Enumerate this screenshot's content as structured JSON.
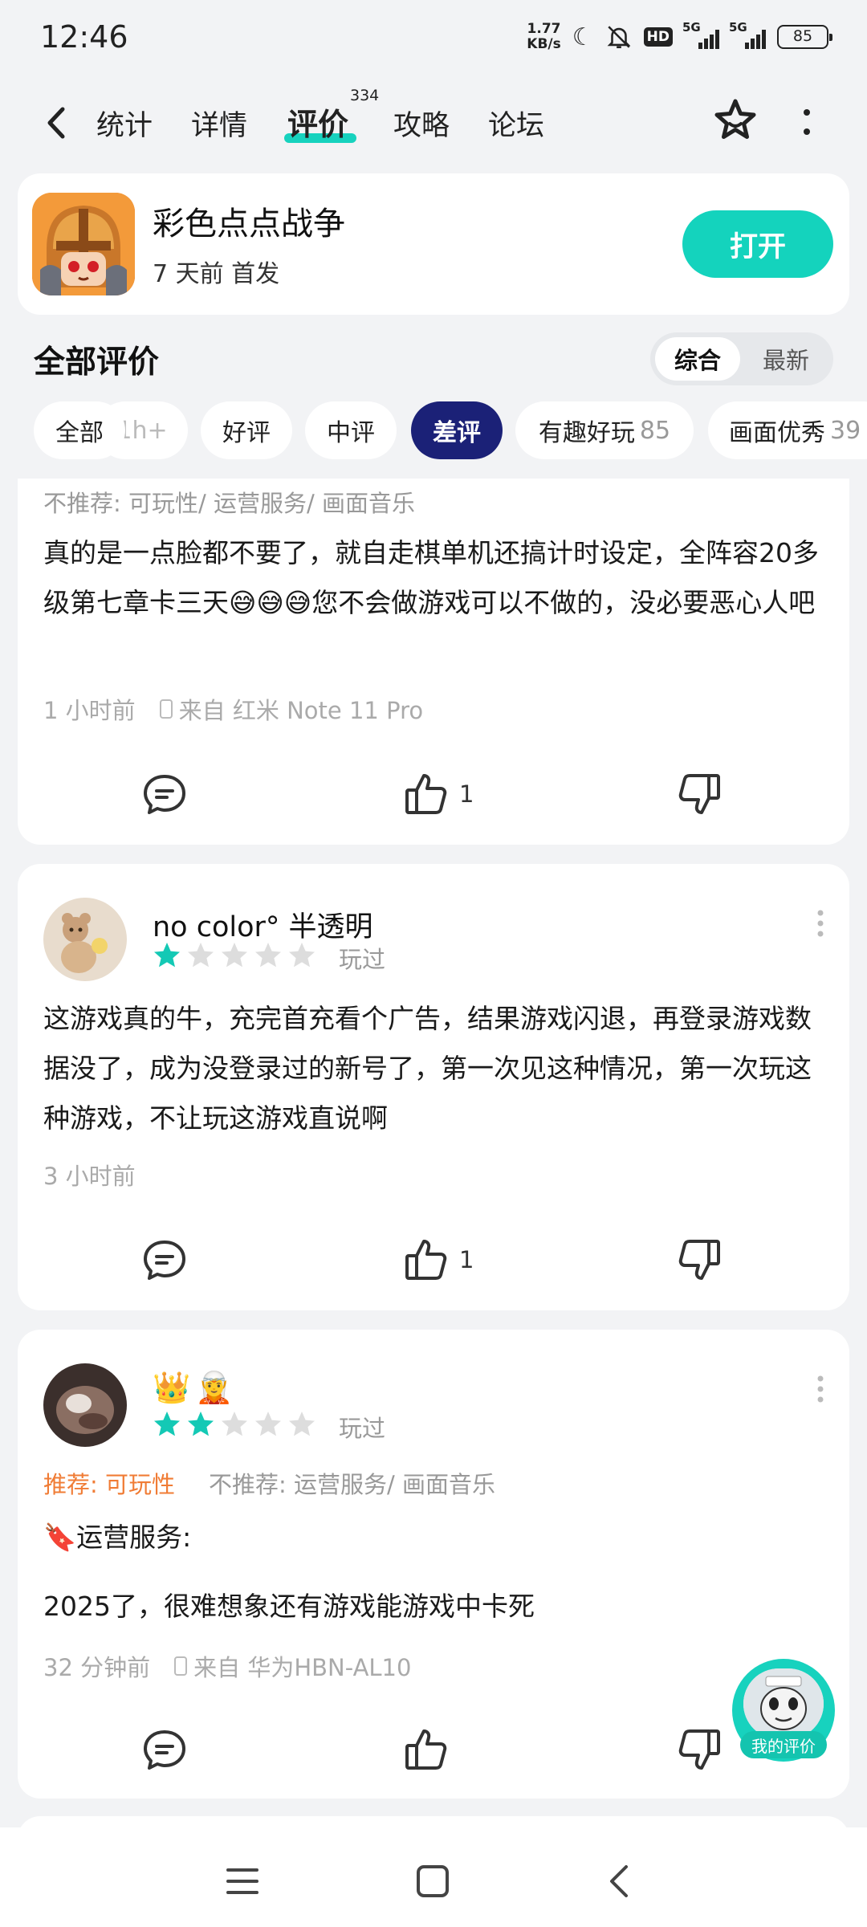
{
  "status_bar": {
    "time": "12:46",
    "net_speed_value": "1.77",
    "net_speed_unit": "KB/s",
    "hd_label": "HD",
    "signal1_label": "5G",
    "signal2_label": "5G",
    "battery": "85"
  },
  "nav": {
    "tabs": [
      {
        "label": "统计"
      },
      {
        "label": "详情"
      },
      {
        "label": "评价",
        "count": "334"
      },
      {
        "label": "攻略"
      },
      {
        "label": "论坛"
      }
    ],
    "active_tab": "评价"
  },
  "game": {
    "title": "彩色点点战争",
    "subtitle": "7 天前 首发",
    "open_label": "打开"
  },
  "reviews_header": {
    "title": "全部评价",
    "sort_options": [
      "综合",
      "最新"
    ],
    "active_sort": "综合"
  },
  "filters": [
    {
      "label": "全部"
    },
    {
      "label": "1h+"
    },
    {
      "label": "好评"
    },
    {
      "label": "中评"
    },
    {
      "label": "差评"
    },
    {
      "label": "有趣好玩",
      "count": "85"
    },
    {
      "label": "画面优秀",
      "count": "39"
    }
  ],
  "active_filter": "差评",
  "reviews": [
    {
      "tags_negative": "不推荐: 可玩性/ 运营服务/ 画面音乐",
      "body": "真的是一点脸都不要了，就自走棋单机还搞计时设定，全阵容20多级第七章卡三天😅😅😅您不会做游戏可以不做的，没必要恶心人吧",
      "time": "1 小时前",
      "device": "来自 红米 Note 11 Pro",
      "likes": "1"
    },
    {
      "name": "no color° 半透明",
      "rating": 1,
      "status": "玩过",
      "body": "这游戏真的牛，充完首充看个广告，结果游戏闪退，再登录游戏数据没了，成为没登录过的新号了，第一次见这种情况，第一次玩这种游戏，不让玩这游戏直说啊",
      "time": "3 小时前",
      "likes": "1"
    },
    {
      "name_badges": [
        "👑",
        "🧝"
      ],
      "rating": 2,
      "status": "玩过",
      "tags_positive": "推荐: 可玩性",
      "tags_negative": "不推荐: 运营服务/ 画面音乐",
      "section_heading": "🔖运营服务:",
      "body": "2025了，很难想象还有游戏能游戏中卡死",
      "time": "32 分钟前",
      "device": "来自 华为HBN-AL10"
    }
  ],
  "floating_button": {
    "label": "我的评价"
  },
  "colors": {
    "accent": "#14d3bd",
    "active_chip": "#1b2177",
    "star_filled": "#14c9b5",
    "star_empty": "#dddddd",
    "positive_tag": "#f07c35"
  }
}
